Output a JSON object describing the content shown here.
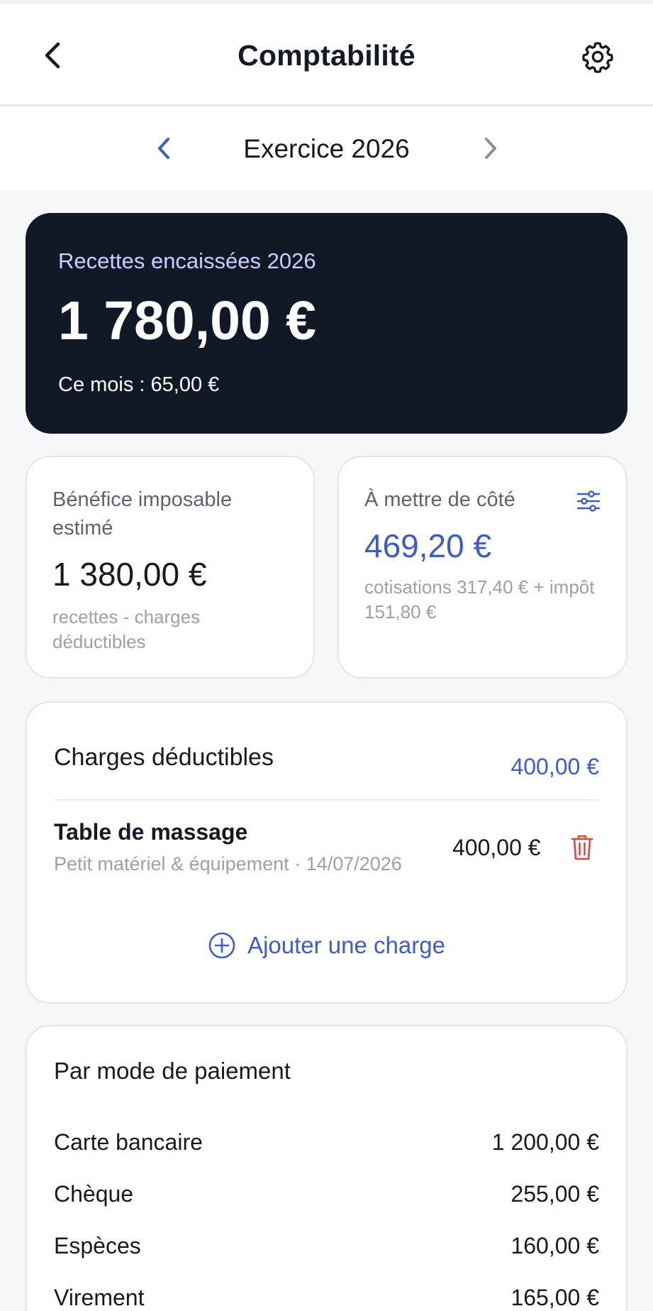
{
  "header": {
    "title": "Comptabilité",
    "back_icon": "chevron-left-icon",
    "settings_icon": "gear-icon"
  },
  "year_selector": {
    "label": "Exercice 2026",
    "prev_icon": "chevron-left-icon",
    "next_icon": "chevron-right-icon"
  },
  "summary": {
    "label": "Recettes encaissées 2026",
    "amount": "1 780,00 €",
    "month": "Ce mois : 65,00 €"
  },
  "benefit_card": {
    "label": "Bénéfice imposable estimé",
    "value": "1 380,00 €",
    "note": "recettes - charges déductibles"
  },
  "set_aside_card": {
    "label": "À mettre de côté",
    "value": "469,20 €",
    "note": "cotisations 317,40 € + impôt 151,80 €",
    "icon": "sliders-icon"
  },
  "charges": {
    "heading": "Charges déductibles",
    "total": "400,00 €",
    "items": [
      {
        "name": "Table de massage",
        "meta": "Petit matériel & équipement · 14/07/2026",
        "amount": "400,00 €"
      }
    ],
    "add_label": "Ajouter une charge"
  },
  "payment_modes": {
    "heading": "Par mode de paiement",
    "rows": [
      {
        "name": "Carte bancaire",
        "amount": "1 200,00 €"
      },
      {
        "name": "Chèque",
        "amount": "255,00 €"
      },
      {
        "name": "Espèces",
        "amount": "160,00 €"
      },
      {
        "name": "Virement",
        "amount": "165,00 €"
      }
    ]
  },
  "colors": {
    "accent": "#3f5bc6",
    "hero_bg": "#111826",
    "danger": "#e0483b"
  }
}
